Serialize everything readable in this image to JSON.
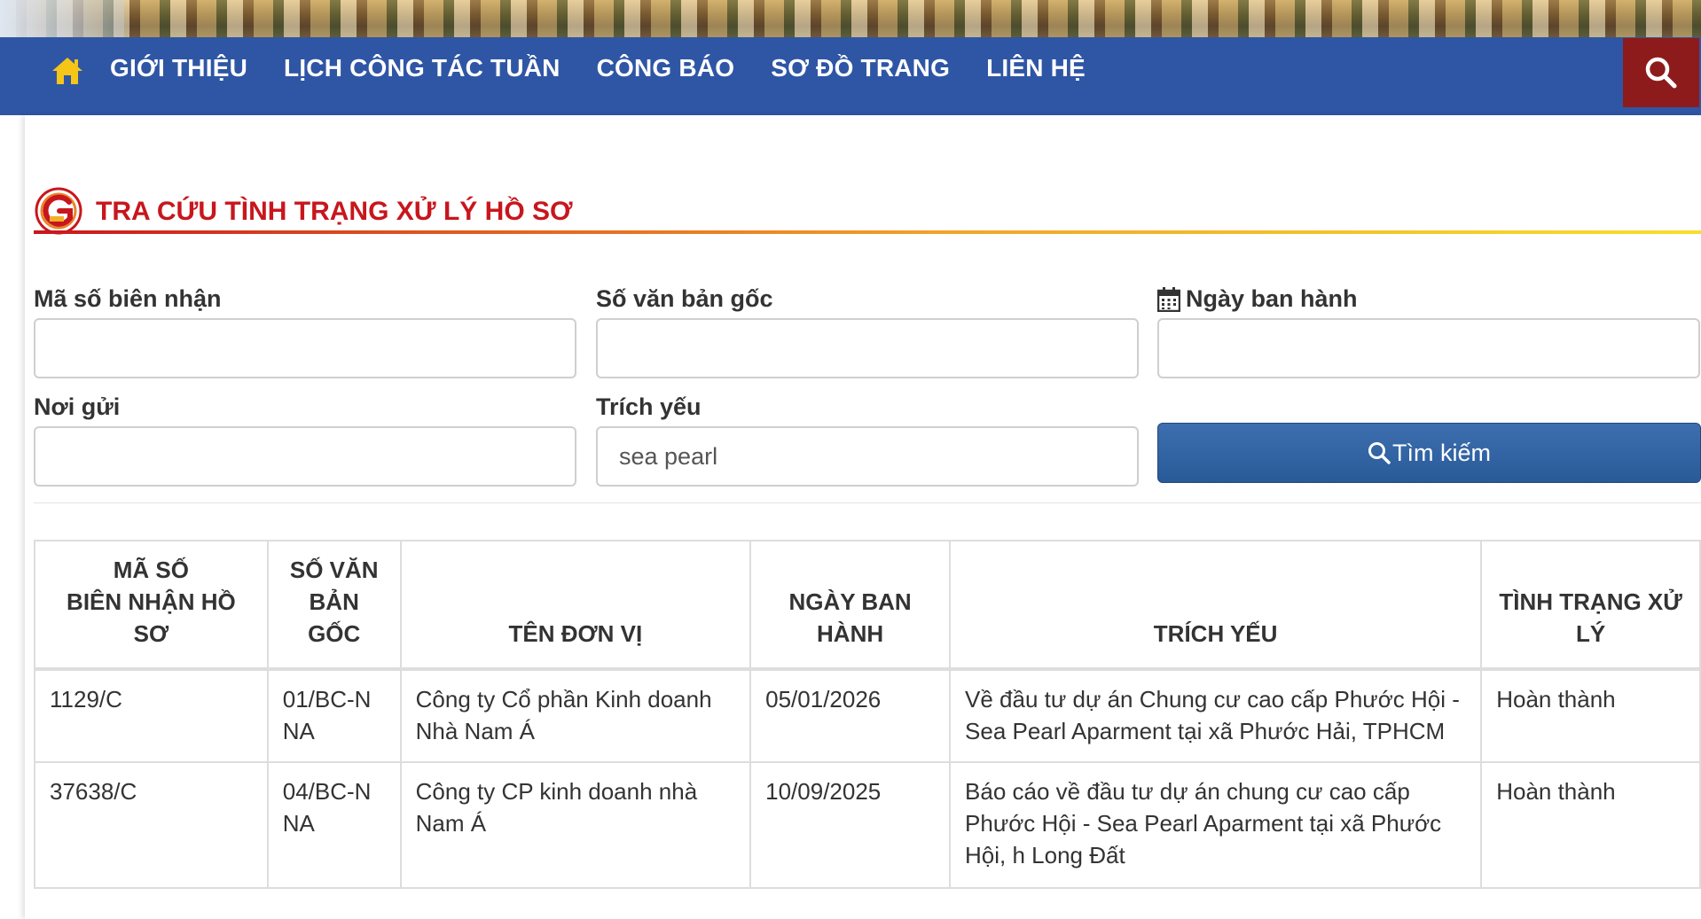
{
  "nav": {
    "items": [
      "GIỚI THIỆU",
      "LỊCH CÔNG TÁC TUẦN",
      "CÔNG BÁO",
      "SƠ ĐỒ TRANG",
      "LIÊN HỆ"
    ],
    "home_icon": "home-icon",
    "search_icon": "search-icon"
  },
  "section": {
    "title": "TRA CỨU TÌNH TRẠNG XỬ LÝ HỒ SƠ"
  },
  "form": {
    "receipt_label": "Mã số biên nhận",
    "receipt_value": "",
    "original_doc_label": "Số văn bản gốc",
    "original_doc_value": "",
    "issue_date_label": "Ngày ban hành",
    "issue_date_value": "",
    "sender_label": "Nơi gửi",
    "sender_value": "",
    "summary_label": "Trích yếu",
    "summary_value": "sea pearl",
    "search_button_label": "Tìm kiếm"
  },
  "table": {
    "headers": {
      "receipt": [
        "MÃ SỐ",
        "BIÊN NHẬN HỒ",
        "SƠ"
      ],
      "original_doc": [
        "SỐ VĂN",
        "BẢN",
        "GỐC"
      ],
      "unit": [
        "TÊN ĐƠN VỊ"
      ],
      "issue_date": [
        "NGÀY BAN",
        "HÀNH"
      ],
      "summary": [
        "TRÍCH YẾU"
      ],
      "status": [
        "TÌNH TRẠNG XỬ",
        "LÝ"
      ]
    },
    "rows": [
      {
        "receipt": "1129/C",
        "original_doc": "01/BC-NNA",
        "unit": "Công ty Cổ phần Kinh doanh Nhà Nam Á",
        "issue_date": "05/01/2026",
        "summary": "Về đầu tư dự án Chung cư cao cấp Phước Hội - Sea Pearl Aparment tại xã Phước Hải, TPHCM",
        "status": "Hoàn thành"
      },
      {
        "receipt": "37638/C",
        "original_doc": "04/BC-NNA",
        "unit": "Công ty CP kinh doanh nhà Nam Á",
        "issue_date": "10/09/2025",
        "summary": "Báo cáo về đầu tư dự án chung cư cao cấp Phước Hội - Sea Pearl Aparment tại xã Phước Hội, h Long Đất",
        "status": "Hoàn thành"
      }
    ]
  },
  "colors": {
    "nav_bg": "#2f56a5",
    "search_bg": "#8e1b1b",
    "title_red": "#c8161d",
    "button_blue": "#2e619f"
  }
}
